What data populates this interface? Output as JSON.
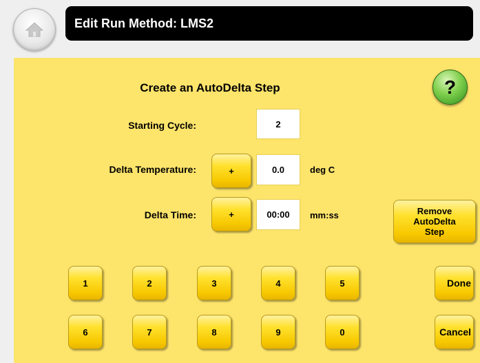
{
  "header": {
    "home_icon": "home-icon",
    "title": "Edit Run Method: LMS2"
  },
  "main": {
    "heading": "Create an AutoDelta Step",
    "help_label": "?",
    "starting_cycle": {
      "label": "Starting Cycle:",
      "value": "2"
    },
    "delta_temperature": {
      "label": "Delta Temperature:",
      "sign": "+",
      "value": "0.0",
      "unit": "deg C"
    },
    "delta_time": {
      "label": "Delta Time:",
      "sign": "+",
      "value": "00:00",
      "unit": "mm:ss"
    },
    "remove_button": "Remove\nAutoDelta\nStep",
    "keypad": [
      "1",
      "2",
      "3",
      "4",
      "5",
      "6",
      "7",
      "8",
      "9",
      "0"
    ],
    "done_button": "Done",
    "cancel_button": "Cancel"
  },
  "colors": {
    "panel": "#fde46b",
    "button": "#ffe12e",
    "title_bar": "#000000",
    "help": "#7fcf4c"
  }
}
